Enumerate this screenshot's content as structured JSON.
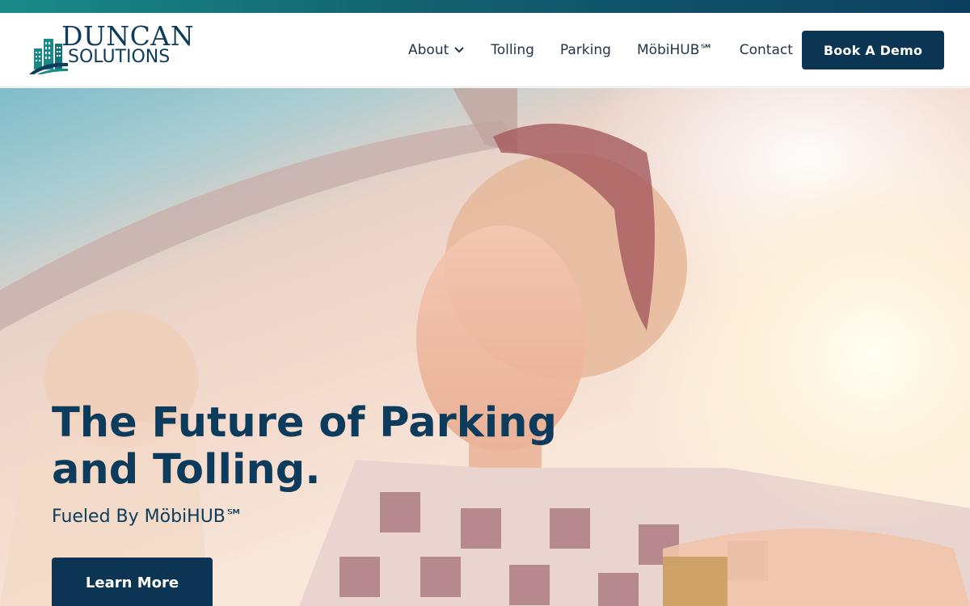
{
  "brand": {
    "name_line1": "DUNCAN",
    "name_line2": "SOLUTIONS",
    "logo_icon": "city-buildings-road-icon",
    "colors": {
      "primary": "#0b3553",
      "teal": "#1a8a89"
    }
  },
  "nav": {
    "items": [
      {
        "label": "About",
        "has_dropdown": true
      },
      {
        "label": "Tolling"
      },
      {
        "label": "Parking"
      },
      {
        "label": "MöbiHUB℠"
      },
      {
        "label": "Contact"
      }
    ],
    "cta_label": "Book A Demo"
  },
  "hero": {
    "title": "The Future of Parking and Tolling.",
    "subtitle": "Fueled By MöbiHUB℠",
    "button_label": "Learn More"
  }
}
